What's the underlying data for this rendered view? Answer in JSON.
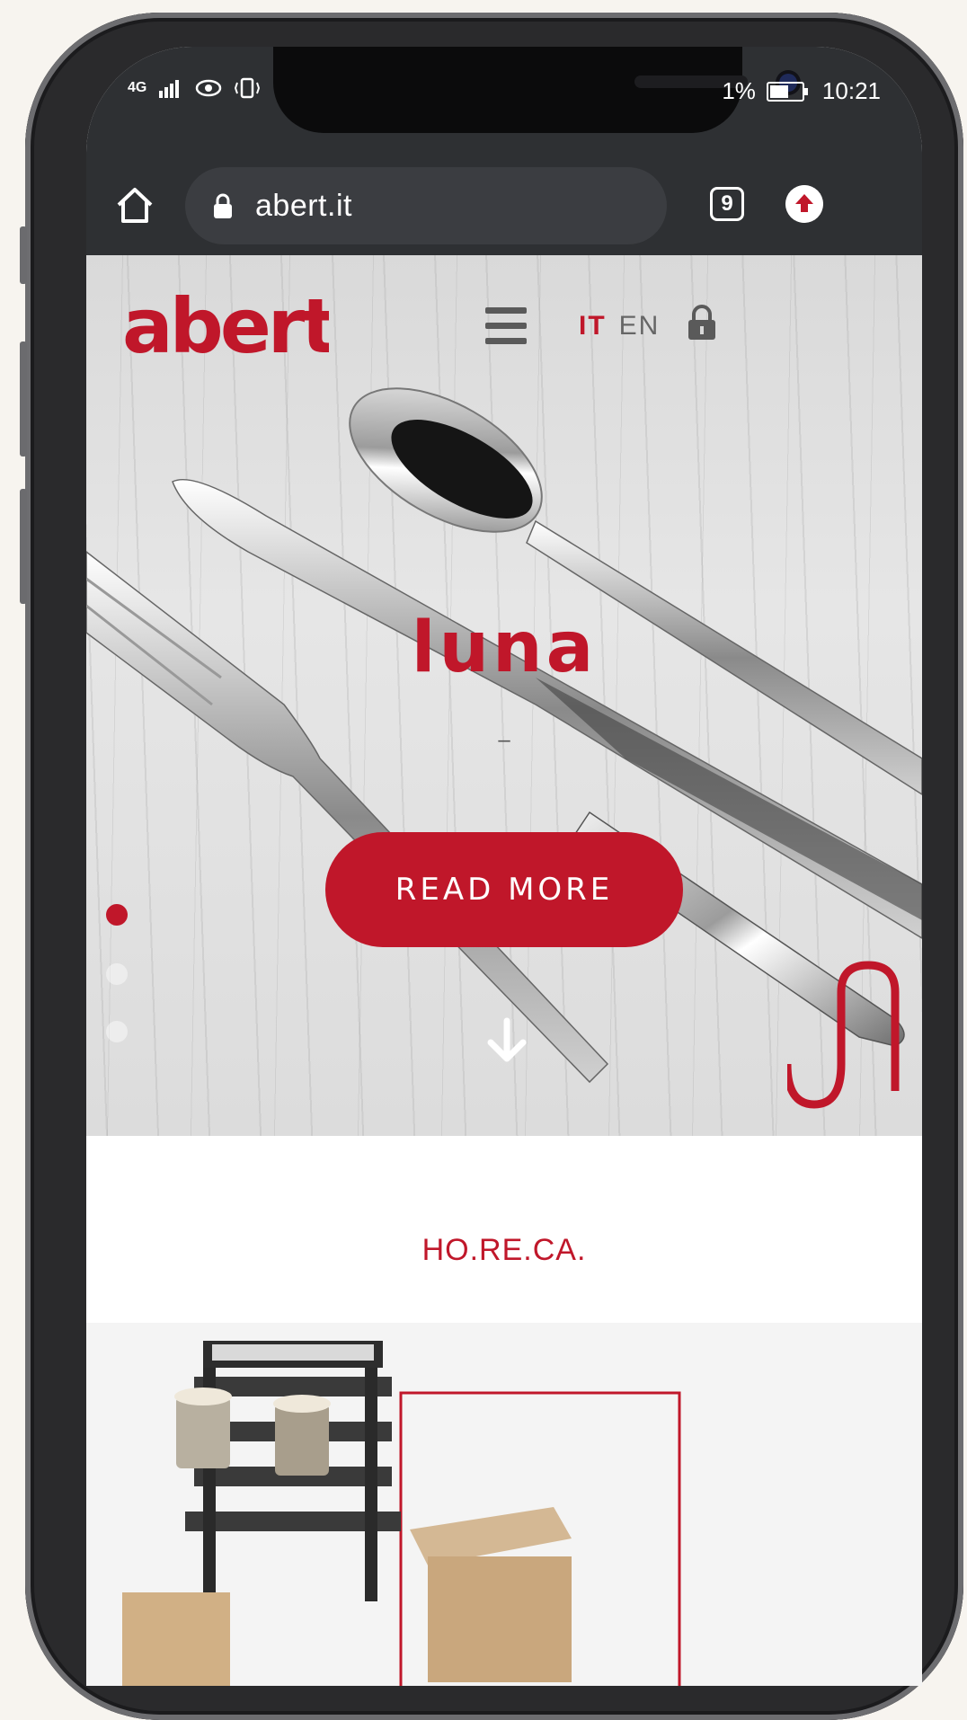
{
  "status_bar": {
    "network": "4G",
    "battery_text": "1%",
    "time": "10:21"
  },
  "browser": {
    "url": "abert.it",
    "tab_count": "9"
  },
  "site": {
    "logo_text": "abert",
    "lang_it": "IT",
    "lang_en": "EN"
  },
  "hero": {
    "title": "luna",
    "dash": "–",
    "button_label": "READ MORE",
    "slide_count": 3,
    "active_slide": 1
  },
  "section": {
    "title": "HO.RE.CA."
  },
  "colors": {
    "brand_red": "#c0172a",
    "chrome_dark": "#2e3033"
  }
}
